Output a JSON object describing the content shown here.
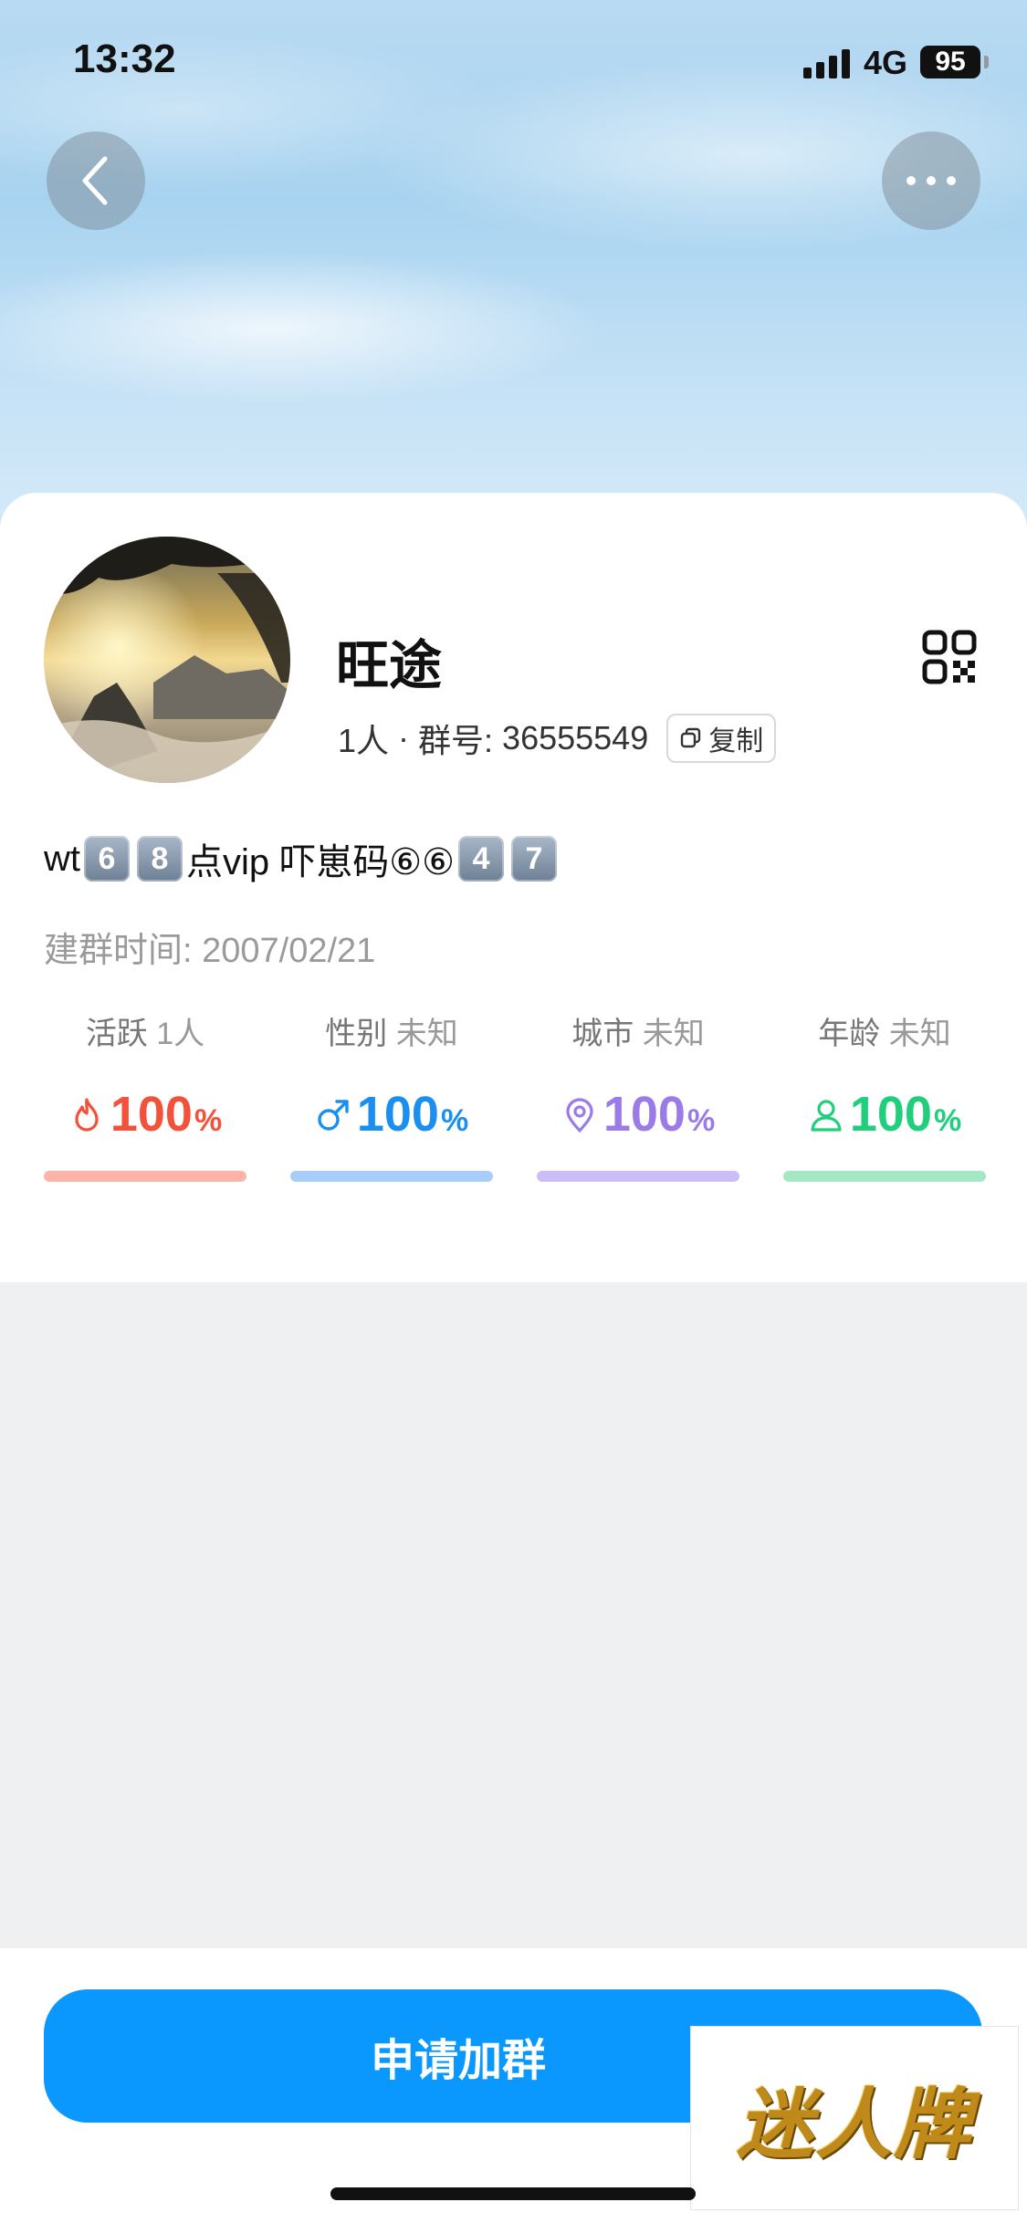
{
  "status_bar": {
    "time": "13:32",
    "network": "4G",
    "battery": "95"
  },
  "header": {
    "back_icon": "chevron-left-icon",
    "more_icon": "ellipsis-icon"
  },
  "group": {
    "name": "旺途",
    "members": "1人",
    "separator": "·",
    "id_label": "群号:",
    "id_value": "36555549",
    "copy_label": "复制",
    "qr_icon": "qr-code-icon",
    "description": {
      "prefix": "wt",
      "k1": "6",
      "k2": "8",
      "mid": "点vip 吓崽码⑥⑥",
      "k3": "4",
      "k4": "7"
    },
    "created": "建群时间: 2007/02/21"
  },
  "stats": [
    {
      "label": "活跃",
      "sub": "1人",
      "value": "100",
      "unit": "%",
      "icon": "flame-icon",
      "color": "#f2513b",
      "bar_color": "#ffb3a7"
    },
    {
      "label": "性别",
      "sub": "未知",
      "value": "100",
      "unit": "%",
      "icon": "male-icon",
      "color": "#1a8ff0",
      "bar_color": "#a8cdfb"
    },
    {
      "label": "城市",
      "sub": "未知",
      "value": "100",
      "unit": "%",
      "icon": "location-pin-icon",
      "color": "#9a7be8",
      "bar_color": "#cbbdf7"
    },
    {
      "label": "年龄",
      "sub": "未知",
      "value": "100",
      "unit": "%",
      "icon": "person-icon",
      "color": "#1fcf7b",
      "bar_color": "#a2e8c4"
    }
  ],
  "actions": {
    "join_label": "申请加群"
  },
  "watermark": {
    "text": "迷人牌"
  }
}
